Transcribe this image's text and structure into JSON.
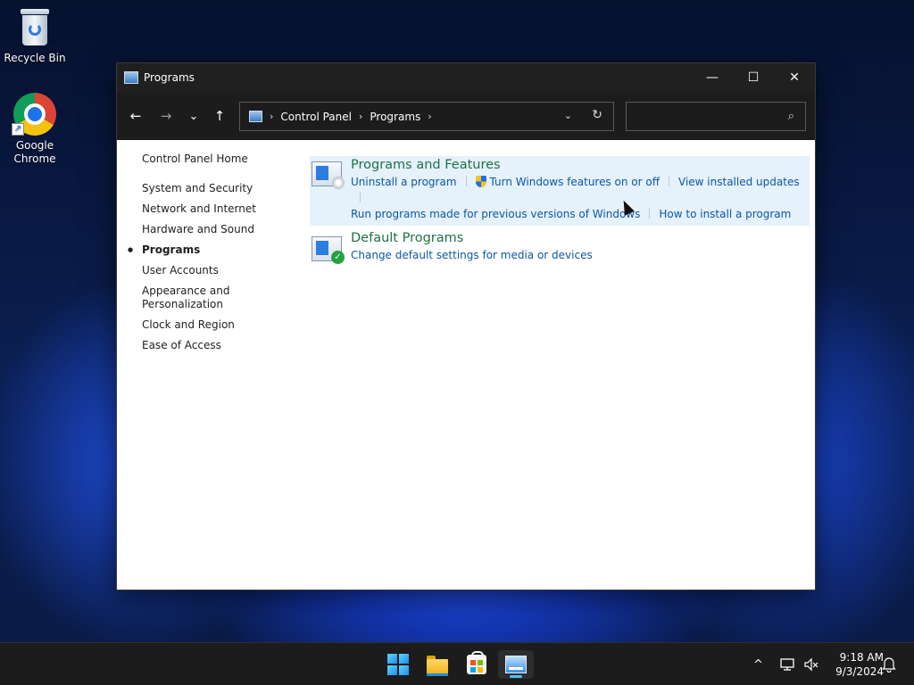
{
  "desktop": {
    "icons": [
      {
        "label": "Recycle Bin"
      },
      {
        "label": "Google Chrome"
      }
    ]
  },
  "window": {
    "title": "Programs",
    "controls": {
      "minimize": "—",
      "maximize": "☐",
      "close": "✕"
    }
  },
  "navbar": {
    "back": "←",
    "forward": "→",
    "recent": "⌄",
    "up": "↑",
    "breadcrumb": [
      "Control Panel",
      "Programs"
    ],
    "separator": "›",
    "dropdown": "⌄",
    "refresh": "↻",
    "search_placeholder": "",
    "search_icon": "⌕"
  },
  "sidebar": {
    "home": "Control Panel Home",
    "items": [
      {
        "label": "System and Security"
      },
      {
        "label": "Network and Internet"
      },
      {
        "label": "Hardware and Sound"
      },
      {
        "label": "Programs"
      },
      {
        "label": "User Accounts"
      },
      {
        "label": "Appearance and Personalization"
      },
      {
        "label": "Clock and Region"
      },
      {
        "label": "Ease of Access"
      }
    ]
  },
  "main": {
    "sections": [
      {
        "heading": "Programs and Features",
        "links": [
          "Uninstall a program",
          "Turn Windows features on or off",
          "View installed updates",
          "Run programs made for previous versions of Windows",
          "How to install a program"
        ]
      },
      {
        "heading": "Default Programs",
        "links": [
          "Change default settings for media or devices"
        ]
      }
    ]
  },
  "taskbar": {
    "tray_chevron": "^",
    "time": "9:18 AM",
    "date": "9/3/2024"
  },
  "colors": {
    "heading_green": "#1e7145",
    "link_blue": "#0b57a7",
    "highlight": "#e5f1fb",
    "titlebar": "#202020"
  }
}
